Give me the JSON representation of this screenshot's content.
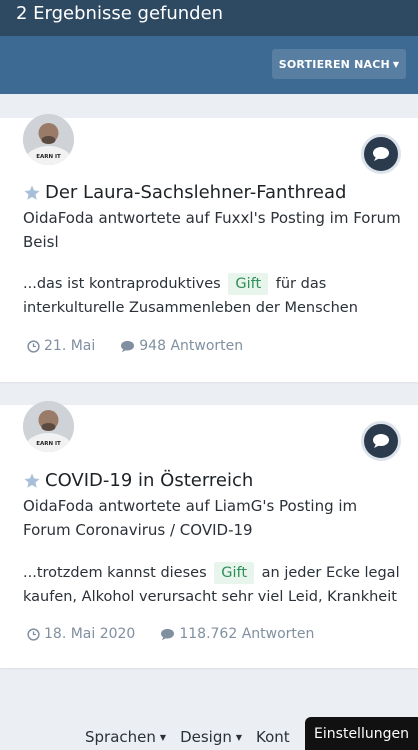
{
  "header": {
    "results_count": "2 Ergebnisse gefunden",
    "sort_label": "SORTIEREN NACH"
  },
  "results": [
    {
      "avatar_shirt_text": "EARN IT",
      "title": "Der Laura-Sachslehner-Fanthread",
      "meta": "OidaFoda antwortete auf Fuxxl's Posting im Forum Beisl",
      "snippet_before": "...das ist kontraproduktives",
      "snippet_highlight": "Gift",
      "snippet_after": "für das interkulturelle Zusammenleben der Menschen",
      "date": "21. Mai",
      "replies": "948 Antworten"
    },
    {
      "avatar_shirt_text": "EARN IT",
      "title": "COVID-19 in Österreich",
      "meta": "OidaFoda antwortete auf LiamG's Posting im Forum Coronavirus / COVID-19",
      "snippet_before": "...trotzdem kannst dieses",
      "snippet_highlight": "Gift",
      "snippet_after": "an jeder Ecke legal kaufen, Alkohol verursacht sehr viel Leid, Krankheit",
      "date": "18. Mai 2020",
      "replies": "118.762 Antworten"
    }
  ],
  "footer": {
    "links": [
      "Sprachen",
      "Design",
      "Kont"
    ],
    "settings_label": "Einstellungen"
  },
  "colors": {
    "header_dark": "#2e4a63",
    "header_light": "#3d6a92",
    "highlight_bg": "#e8f5ec",
    "highlight_text": "#2e8f59",
    "muted": "#8090a0"
  }
}
